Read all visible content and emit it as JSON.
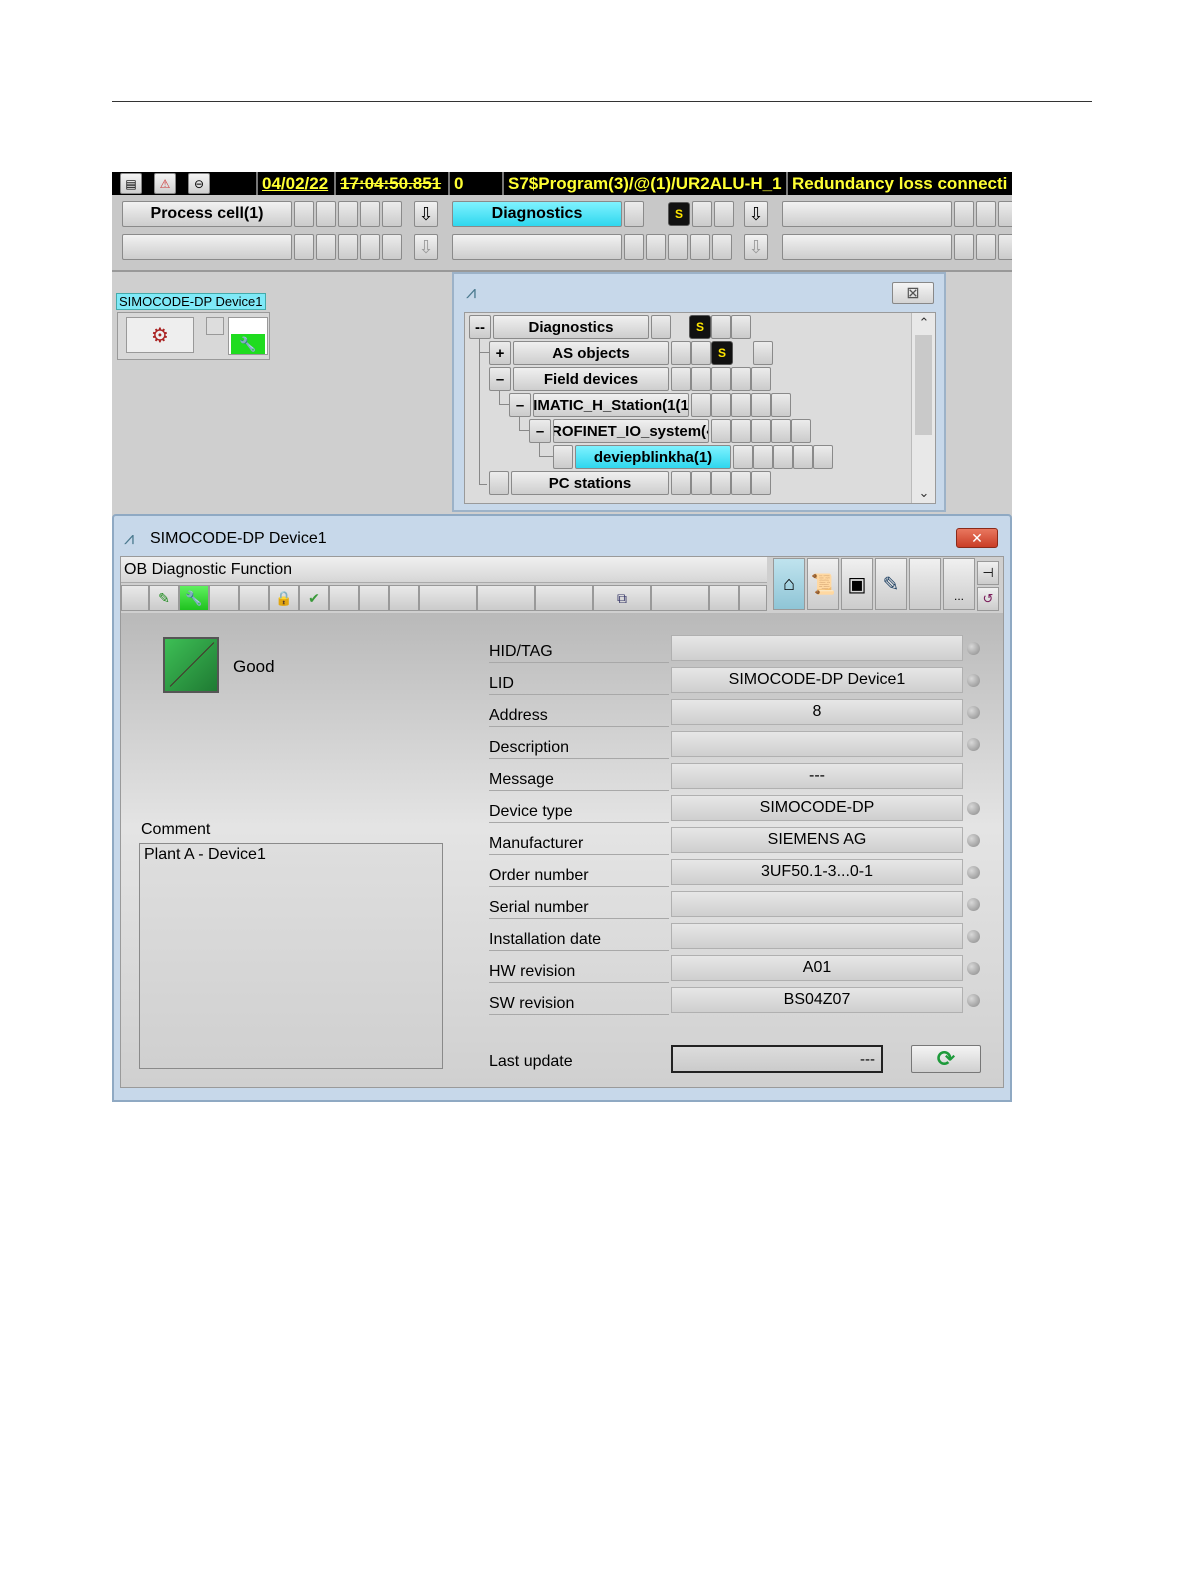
{
  "alarm_bar": {
    "date": "04/02/22",
    "time": "17:04:50.851",
    "counter": "0",
    "source": "S7$Program(3)/@(1)/UR2ALU-H_1",
    "message": "Redundancy loss connecti"
  },
  "areas": {
    "row1": [
      {
        "label": "Process cell(1)"
      },
      {
        "label": "Diagnostics",
        "badge": "S"
      }
    ]
  },
  "block": {
    "label": "SIMOCODE-DP Device1"
  },
  "tree": {
    "nodes": [
      {
        "label": "Diagnostics",
        "expander": "--",
        "badge": "S"
      },
      {
        "label": "AS objects",
        "expander": "+",
        "badge": "S"
      },
      {
        "label": "Field devices",
        "expander": "–"
      },
      {
        "label": "IMATIC_H_Station(1(1",
        "expander": "–"
      },
      {
        "label": "ROFINET_IO_system(‹",
        "expander": "–"
      },
      {
        "label": "deviepblinkha(1)"
      },
      {
        "label": "PC stations"
      }
    ]
  },
  "faceplate": {
    "title": "SIMOCODE-DP Device1",
    "toolbar_title": "OB Diagnostic Function",
    "status": "Good",
    "comment_label": "Comment",
    "comment_value": "Plant A - Device1",
    "params": [
      {
        "label": "HID/TAG",
        "value": "",
        "led": true
      },
      {
        "label": "LID",
        "value": "SIMOCODE-DP Device1",
        "led": true
      },
      {
        "label": "Address",
        "value": "8",
        "led": true
      },
      {
        "label": "Description",
        "value": "",
        "led": true
      },
      {
        "label": "Message",
        "value": "---",
        "led": false
      },
      {
        "label": "Device type",
        "value": "SIMOCODE-DP",
        "led": true
      },
      {
        "label": "Manufacturer",
        "value": "SIEMENS AG",
        "led": true
      },
      {
        "label": "Order number",
        "value": "3UF50.1-3...0-1",
        "led": true
      },
      {
        "label": "Serial number",
        "value": "",
        "led": true
      },
      {
        "label": "Installation date",
        "value": "",
        "led": true
      },
      {
        "label": "HW revision",
        "value": "A01",
        "led": true
      },
      {
        "label": "SW revision",
        "value": "BS04Z07",
        "led": true
      }
    ],
    "last_update_label": "Last update",
    "last_update_value": "---",
    "dots_label": "...",
    "close_label": "✕"
  },
  "colors": {
    "accent_cyan": "#2fd7ee",
    "alarm_text": "#ffff33",
    "status_good": "#2f9e44",
    "close_red": "#c93d26"
  }
}
